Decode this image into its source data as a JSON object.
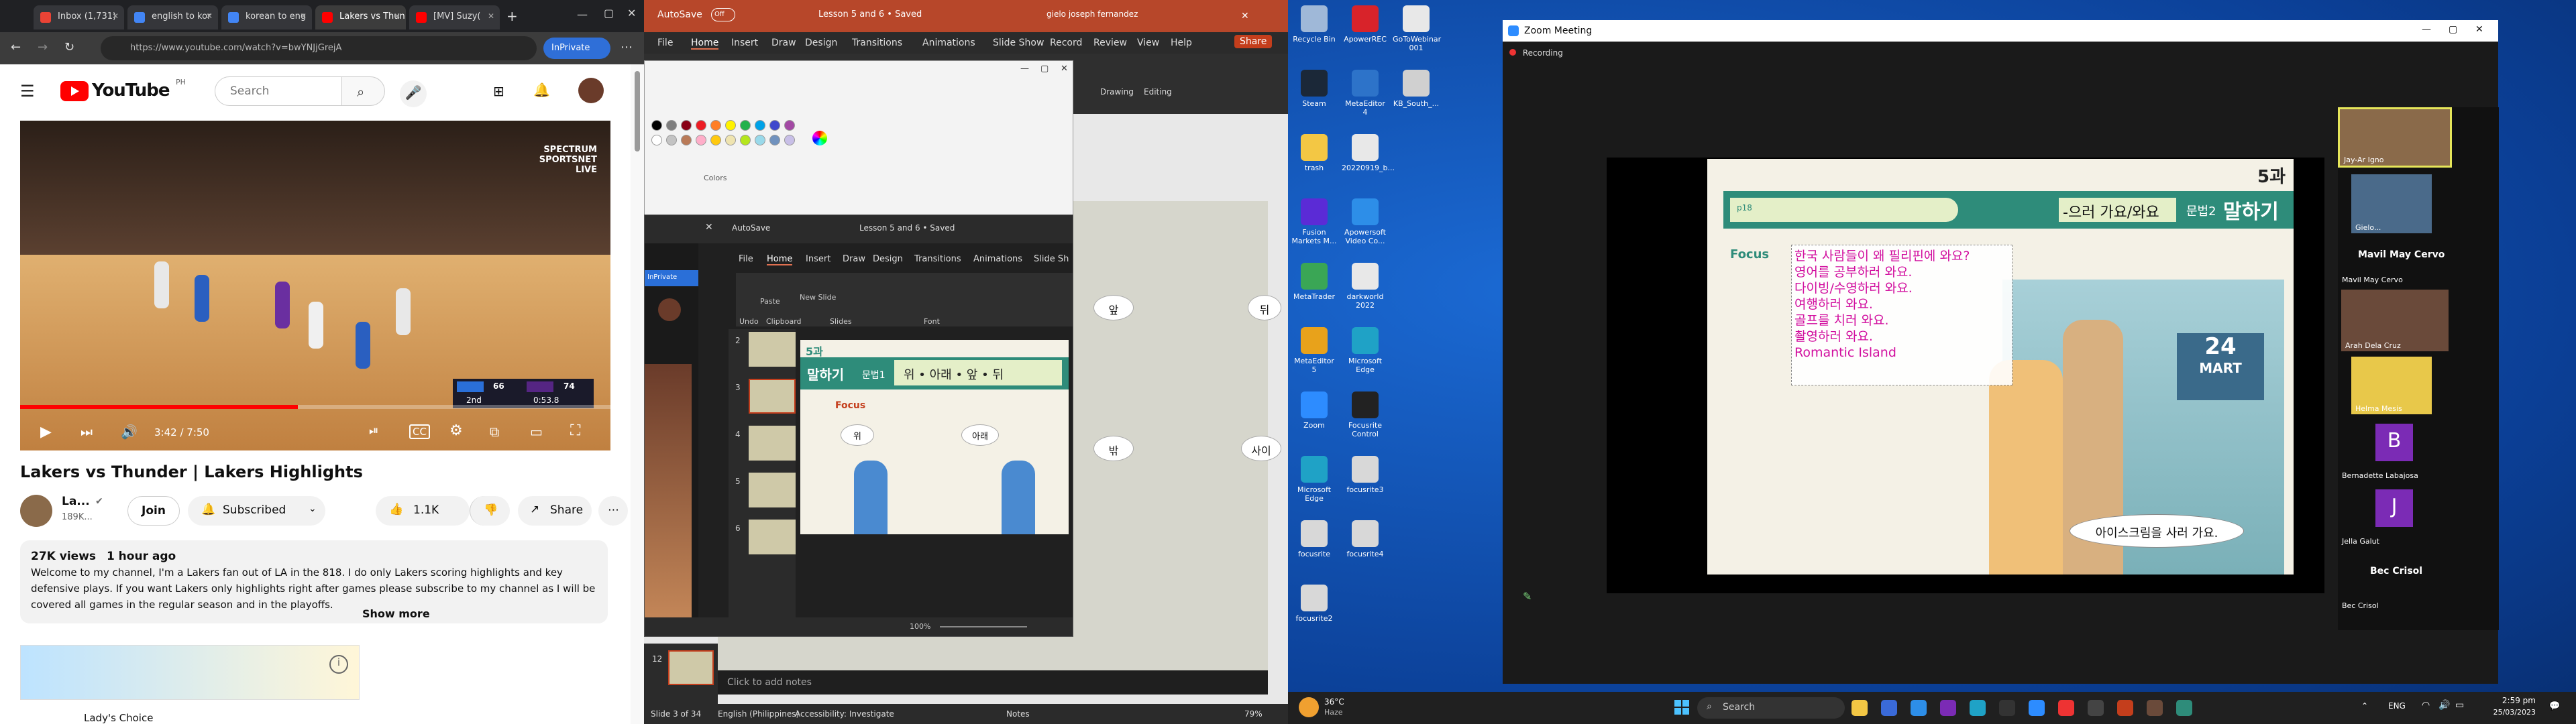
{
  "browser": {
    "tabs": [
      {
        "label": "Inbox (1,731)",
        "color": "#ea4335"
      },
      {
        "label": "english to kor",
        "color": "#4285f4"
      },
      {
        "label": "korean to eng",
        "color": "#4285f4"
      },
      {
        "label": "Lakers vs Thun",
        "color": "#ff0000"
      },
      {
        "label": "[MV] Suzy(",
        "color": "#ff0000"
      }
    ],
    "new_tab": "+",
    "url": "https://www.youtube.com/watch?v=bwYNJjGrejA",
    "inprivate": "InPrivate"
  },
  "youtube": {
    "logo": "YouTube",
    "region": "PH",
    "search_placeholder": "Search",
    "overlay_logo": "SPECTRUM SPORTSNET LIVE",
    "scoreboard": {
      "team1": "66",
      "team2": "74",
      "period": "2nd",
      "clock": "0:53.8"
    },
    "time": "3:42 / 7:50",
    "progress_fraction": 0.47,
    "title": "Lakers vs Thunder | Lakers Highlights",
    "channel": "La...",
    "subscribers": "189K...",
    "join": "Join",
    "subscribed": "Subscribed",
    "likes": "1.1K",
    "share": "Share",
    "views": "27K views",
    "posted": "1 hour ago",
    "description": "Welcome to my channel, I'm a Lakers fan out of LA in the 818. I do only Lakers scoring highlights and key defensive plays. If you want Lakers only highlights right after games please subscribe to my channel as I will be covered all games in the regular season and in the playoffs.",
    "show_more": "Show more",
    "next_title": "Lady's Choice"
  },
  "powerpoint": {
    "title": "Lesson 5 and 6 • Saved",
    "autosave": "AutoSave",
    "off": "Off",
    "user": "gielo joseph fernandez",
    "share": "Share",
    "tabs": [
      "File",
      "Home",
      "Insert",
      "Draw",
      "Design",
      "Transitions",
      "Animations",
      "Slide Show",
      "Record",
      "Review",
      "View",
      "Help"
    ],
    "ribbon_groups": [
      "Drawing",
      "Editing"
    ],
    "add_notes": "Click to add notes",
    "status": "Slide 3 of 34",
    "language": "English (Philippines)",
    "accessibility": "Accessibility: Investigate",
    "notes": "Notes",
    "zoom": "79%"
  },
  "paint": {
    "colors_label": "Colors",
    "palette": [
      "#000000",
      "#7f7f7f",
      "#880015",
      "#ed1c24",
      "#ff7f27",
      "#fff200",
      "#22b14c",
      "#00a2e8",
      "#3f48cc",
      "#a349a4",
      "#ffffff",
      "#c3c3c3",
      "#b97a57",
      "#ffaec9",
      "#ffc90e",
      "#efe4b0",
      "#b5e61d",
      "#99d9ea",
      "#7092be",
      "#c8bfe7"
    ]
  },
  "ppt2": {
    "autosave": "AutoSave",
    "title": "Lesson 5 and 6 • Saved",
    "tabs": [
      "File",
      "Home",
      "Insert",
      "Draw",
      "Design",
      "Transitions",
      "Animations",
      "Slide Sh"
    ],
    "groups": [
      "Undo",
      "Clipboard",
      "Slides",
      "Font"
    ],
    "paste": "Paste",
    "new_slide": "New Slide",
    "thumbnails": [
      "2",
      "3",
      "4",
      "5",
      "6"
    ],
    "slide_num": "12",
    "slide_header": "말하기",
    "slide_grammar": "문법1",
    "slide_words": "위 • 아래 • 앞 • 뒤",
    "slide_lesson": "5과",
    "focus": "Focus",
    "bubble1": "위",
    "bubble2": "아래",
    "zoom": "100%"
  },
  "ppt_bg_slide": {
    "labels": [
      "앞",
      "뒤",
      "밖",
      "사이"
    ]
  },
  "desktop": {
    "icons": [
      {
        "label": "Recycle Bin",
        "color": "#9fb8d8"
      },
      {
        "label": "ApowerREC",
        "color": "#d8232a"
      },
      {
        "label": "GoToWebinar 001",
        "color": "#e8e8e8"
      },
      {
        "label": "Steam",
        "color": "#1b2838"
      },
      {
        "label": "MetaEditor 4",
        "color": "#2d73c9"
      },
      {
        "label": "KB_South_...",
        "color": "#d0d0d0"
      },
      {
        "label": "trash",
        "color": "#f3c744"
      },
      {
        "label": "20220919_b...",
        "color": "#e8e8e8"
      },
      {
        "label": "Fusion Markets M...",
        "color": "#5b2bd6"
      },
      {
        "label": "Apowersoft Video Co...",
        "color": "#2d8ee8"
      },
      {
        "label": "MetaTrader",
        "color": "#3aa655"
      },
      {
        "label": "darkworld 2022",
        "color": "#e8e8e8"
      },
      {
        "label": "MetaEditor 5",
        "color": "#e8a21b"
      },
      {
        "label": "Microsoft Edge",
        "color": "#1fa2c6"
      },
      {
        "label": "Zoom",
        "color": "#2d8cff"
      },
      {
        "label": "Focusrite Control",
        "color": "#222222"
      },
      {
        "label": "Microsoft Edge",
        "color": "#1fa2c6"
      },
      {
        "label": "focusrite3",
        "color": "#d8d8d8"
      },
      {
        "label": "focusrite",
        "color": "#d8d8d8"
      },
      {
        "label": "focusrite4",
        "color": "#d8d8d8"
      },
      {
        "label": "focusrite2",
        "color": "#d8d8d8"
      }
    ]
  },
  "zoom": {
    "title": "Zoom Meeting",
    "recording": "Recording",
    "slide": {
      "lesson": "5과",
      "pg": "p18",
      "grammar_form": "-으러 가요/와요",
      "grammar": "문법2",
      "speaking": "말하기",
      "focus": "Focus",
      "lines": [
        "한국 사람들이 왜 필리핀에 와요?",
        "영어를 공부하러 와요.",
        "다이빙/수영하러 와요.",
        "여행하러 와요.",
        "골프를 치러 와요.",
        "촬영하러 와요.",
        "Romantic Island"
      ],
      "mart": "24",
      "mart_label": "MART",
      "bubble": "아이스크림을 사러 가요."
    },
    "participants": [
      {
        "name": "Jay-Ar Igno",
        "color": "#8a6a4a"
      },
      {
        "name": "Gielo...",
        "color": "#4a6a8a"
      },
      {
        "name": "Mavil May Cervo",
        "color": ""
      },
      {
        "name": "Arah Dela Cruz",
        "color": "#6a4a3a"
      },
      {
        "name": "Helma Mesis",
        "color": "#e8c84a"
      },
      {
        "name": "Bernadette Labajosa",
        "color": "#7b2bb5"
      },
      {
        "name": "Jella Galut",
        "color": "#7b2bb5"
      },
      {
        "name": "Bec Crisol",
        "color": ""
      }
    ],
    "participant_header_1": "Mavil May Cervo",
    "participant_header_2": "Bec Crisol",
    "initials": [
      "B",
      "J"
    ]
  },
  "taskbar": {
    "weather_temp": "36°C",
    "weather_desc": "Haze",
    "search": "Search",
    "lang": "ENG",
    "time": "2:59 pm",
    "date": "25/03/2023"
  }
}
